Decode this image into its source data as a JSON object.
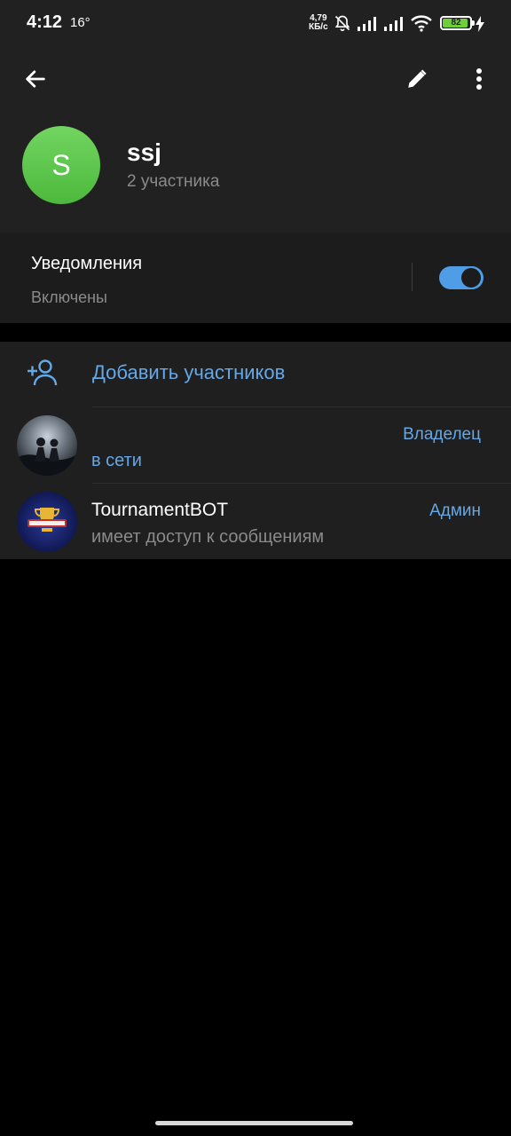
{
  "status_bar": {
    "time": "4:12",
    "temperature": "16°",
    "net_speed_value": "4,79",
    "net_speed_unit": "КБ/с",
    "battery": "82",
    "battery_color": "#6fcf3b"
  },
  "header": {
    "icons": [
      "back-arrow-icon",
      "pencil-icon",
      "more-vertical-icon"
    ]
  },
  "chat": {
    "avatar_letter": "S",
    "avatar_color": "#5fc84f",
    "title": "ssj",
    "subtitle": "2 участника"
  },
  "notifications": {
    "label": "Уведомления",
    "status": "Включены",
    "enabled": true,
    "accent": "#4f9de6"
  },
  "members": {
    "add_label": "Добавить участников",
    "list": [
      {
        "name": "",
        "status": "в сети",
        "role": "Владелец",
        "status_color": "#65a8e8"
      },
      {
        "name": "TournamentBOT",
        "status": "имеет доступ к сообщениям",
        "role": "Админ",
        "status_color": "#8a8a8a"
      }
    ]
  }
}
